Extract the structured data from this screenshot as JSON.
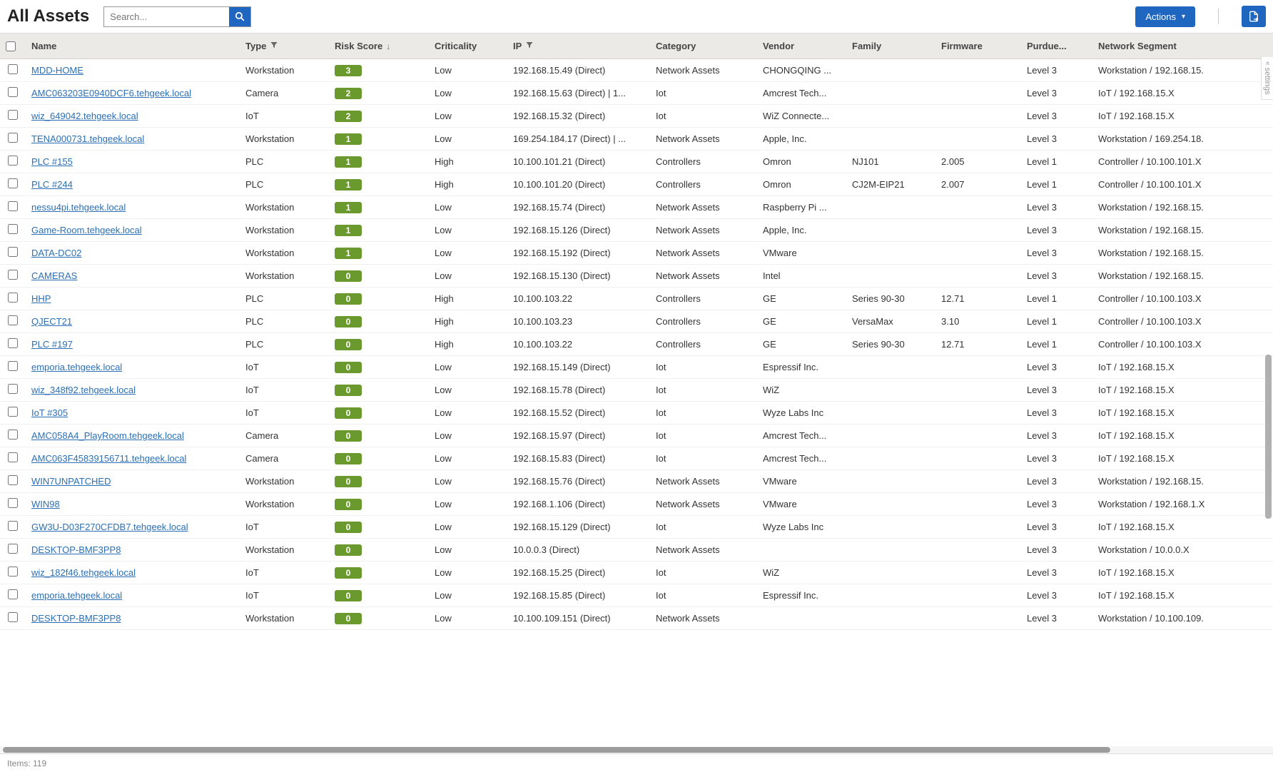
{
  "header": {
    "title": "All Assets",
    "search_placeholder": "Search...",
    "actions_label": "Actions"
  },
  "footer": {
    "items_label": "Items: 119"
  },
  "settings_tab": "settings",
  "columns": [
    {
      "key": "checkbox",
      "label": ""
    },
    {
      "key": "name",
      "label": "Name"
    },
    {
      "key": "type",
      "label": "Type",
      "filter": true
    },
    {
      "key": "risk",
      "label": "Risk Score",
      "sort": "down"
    },
    {
      "key": "crit",
      "label": "Criticality"
    },
    {
      "key": "ip",
      "label": "IP",
      "filter": true
    },
    {
      "key": "cat",
      "label": "Category"
    },
    {
      "key": "vendor",
      "label": "Vendor"
    },
    {
      "key": "family",
      "label": "Family"
    },
    {
      "key": "firmware",
      "label": "Firmware"
    },
    {
      "key": "purdue",
      "label": "Purdue..."
    },
    {
      "key": "seg",
      "label": "Network Segment"
    }
  ],
  "rows": [
    {
      "name": "MDD-HOME",
      "type": "Workstation",
      "risk": "3",
      "crit": "Low",
      "ip": "192.168.15.49 (Direct)",
      "cat": "Network Assets",
      "vendor": "CHONGQING ...",
      "family": "",
      "firmware": "",
      "purdue": "Level 3",
      "seg": "Workstation / 192.168.15."
    },
    {
      "name": "AMC063203E0940DCF6.tehgeek.local",
      "type": "Camera",
      "risk": "2",
      "crit": "Low",
      "ip": "192.168.15.63 (Direct) | 1...",
      "cat": "Iot",
      "vendor": "Amcrest Tech...",
      "family": "",
      "firmware": "",
      "purdue": "Level 3",
      "seg": "IoT / 192.168.15.X"
    },
    {
      "name": "wiz_649042.tehgeek.local",
      "type": "IoT",
      "risk": "2",
      "crit": "Low",
      "ip": "192.168.15.32 (Direct)",
      "cat": "Iot",
      "vendor": "WiZ Connecte...",
      "family": "",
      "firmware": "",
      "purdue": "Level 3",
      "seg": "IoT / 192.168.15.X"
    },
    {
      "name": "TENA000731.tehgeek.local",
      "type": "Workstation",
      "risk": "1",
      "crit": "Low",
      "ip": "169.254.184.17 (Direct) | ...",
      "cat": "Network Assets",
      "vendor": "Apple, Inc.",
      "family": "",
      "firmware": "",
      "purdue": "Level 3",
      "seg": "Workstation / 169.254.18."
    },
    {
      "name": "PLC #155",
      "type": "PLC",
      "risk": "1",
      "crit": "High",
      "ip": "10.100.101.21 (Direct)",
      "cat": "Controllers",
      "vendor": "Omron",
      "family": "NJ101",
      "firmware": "2.005",
      "purdue": "Level 1",
      "seg": "Controller / 10.100.101.X"
    },
    {
      "name": "PLC #244",
      "type": "PLC",
      "risk": "1",
      "crit": "High",
      "ip": "10.100.101.20 (Direct)",
      "cat": "Controllers",
      "vendor": "Omron",
      "family": "CJ2M-EIP21",
      "firmware": "2.007",
      "purdue": "Level 1",
      "seg": "Controller / 10.100.101.X"
    },
    {
      "name": "nessu4pi.tehgeek.local",
      "type": "Workstation",
      "risk": "1",
      "crit": "Low",
      "ip": "192.168.15.74 (Direct)",
      "cat": "Network Assets",
      "vendor": "Raspberry Pi ...",
      "family": "",
      "firmware": "",
      "purdue": "Level 3",
      "seg": "Workstation / 192.168.15."
    },
    {
      "name": "Game-Room.tehgeek.local",
      "type": "Workstation",
      "risk": "1",
      "crit": "Low",
      "ip": "192.168.15.126 (Direct)",
      "cat": "Network Assets",
      "vendor": "Apple, Inc.",
      "family": "",
      "firmware": "",
      "purdue": "Level 3",
      "seg": "Workstation / 192.168.15."
    },
    {
      "name": "DATA-DC02",
      "type": "Workstation",
      "risk": "1",
      "crit": "Low",
      "ip": "192.168.15.192 (Direct)",
      "cat": "Network Assets",
      "vendor": "VMware",
      "family": "",
      "firmware": "",
      "purdue": "Level 3",
      "seg": "Workstation / 192.168.15."
    },
    {
      "name": "CAMERAS",
      "type": "Workstation",
      "risk": "0",
      "crit": "Low",
      "ip": "192.168.15.130 (Direct)",
      "cat": "Network Assets",
      "vendor": "Intel",
      "family": "",
      "firmware": "",
      "purdue": "Level 3",
      "seg": "Workstation / 192.168.15."
    },
    {
      "name": "HHP",
      "type": "PLC",
      "risk": "0",
      "crit": "High",
      "ip": "10.100.103.22",
      "cat": "Controllers",
      "vendor": "GE",
      "family": "Series 90-30",
      "firmware": "12.71",
      "purdue": "Level 1",
      "seg": "Controller / 10.100.103.X"
    },
    {
      "name": "QJECT21",
      "type": "PLC",
      "risk": "0",
      "crit": "High",
      "ip": "10.100.103.23",
      "cat": "Controllers",
      "vendor": "GE",
      "family": "VersaMax",
      "firmware": "3.10",
      "purdue": "Level 1",
      "seg": "Controller / 10.100.103.X"
    },
    {
      "name": "PLC #197",
      "type": "PLC",
      "risk": "0",
      "crit": "High",
      "ip": "10.100.103.22",
      "cat": "Controllers",
      "vendor": "GE",
      "family": "Series 90-30",
      "firmware": "12.71",
      "purdue": "Level 1",
      "seg": "Controller / 10.100.103.X"
    },
    {
      "name": "emporia.tehgeek.local",
      "type": "IoT",
      "risk": "0",
      "crit": "Low",
      "ip": "192.168.15.149 (Direct)",
      "cat": "Iot",
      "vendor": "Espressif Inc.",
      "family": "",
      "firmware": "",
      "purdue": "Level 3",
      "seg": "IoT / 192.168.15.X"
    },
    {
      "name": "wiz_348f92.tehgeek.local",
      "type": "IoT",
      "risk": "0",
      "crit": "Low",
      "ip": "192.168.15.78 (Direct)",
      "cat": "Iot",
      "vendor": "WiZ",
      "family": "",
      "firmware": "",
      "purdue": "Level 3",
      "seg": "IoT / 192.168.15.X"
    },
    {
      "name": "IoT #305",
      "type": "IoT",
      "risk": "0",
      "crit": "Low",
      "ip": "192.168.15.52 (Direct)",
      "cat": "Iot",
      "vendor": "Wyze Labs Inc",
      "family": "",
      "firmware": "",
      "purdue": "Level 3",
      "seg": "IoT / 192.168.15.X"
    },
    {
      "name": "AMC058A4_PlayRoom.tehgeek.local",
      "type": "Camera",
      "risk": "0",
      "crit": "Low",
      "ip": "192.168.15.97 (Direct)",
      "cat": "Iot",
      "vendor": "Amcrest Tech...",
      "family": "",
      "firmware": "",
      "purdue": "Level 3",
      "seg": "IoT / 192.168.15.X"
    },
    {
      "name": "AMC063F45839156711.tehgeek.local",
      "type": "Camera",
      "risk": "0",
      "crit": "Low",
      "ip": "192.168.15.83 (Direct)",
      "cat": "Iot",
      "vendor": "Amcrest Tech...",
      "family": "",
      "firmware": "",
      "purdue": "Level 3",
      "seg": "IoT / 192.168.15.X"
    },
    {
      "name": "WIN7UNPATCHED",
      "type": "Workstation",
      "risk": "0",
      "crit": "Low",
      "ip": "192.168.15.76 (Direct)",
      "cat": "Network Assets",
      "vendor": "VMware",
      "family": "",
      "firmware": "",
      "purdue": "Level 3",
      "seg": "Workstation / 192.168.15."
    },
    {
      "name": "WIN98",
      "type": "Workstation",
      "risk": "0",
      "crit": "Low",
      "ip": "192.168.1.106 (Direct)",
      "cat": "Network Assets",
      "vendor": "VMware",
      "family": "",
      "firmware": "",
      "purdue": "Level 3",
      "seg": "Workstation / 192.168.1.X"
    },
    {
      "name": "GW3U-D03F270CFDB7.tehgeek.local",
      "type": "IoT",
      "risk": "0",
      "crit": "Low",
      "ip": "192.168.15.129 (Direct)",
      "cat": "Iot",
      "vendor": "Wyze Labs Inc",
      "family": "",
      "firmware": "",
      "purdue": "Level 3",
      "seg": "IoT / 192.168.15.X"
    },
    {
      "name": "DESKTOP-BMF3PP8",
      "type": "Workstation",
      "risk": "0",
      "crit": "Low",
      "ip": "10.0.0.3 (Direct)",
      "cat": "Network Assets",
      "vendor": "",
      "family": "",
      "firmware": "",
      "purdue": "Level 3",
      "seg": "Workstation / 10.0.0.X"
    },
    {
      "name": "wiz_182f46.tehgeek.local",
      "type": "IoT",
      "risk": "0",
      "crit": "Low",
      "ip": "192.168.15.25 (Direct)",
      "cat": "Iot",
      "vendor": "WiZ",
      "family": "",
      "firmware": "",
      "purdue": "Level 3",
      "seg": "IoT / 192.168.15.X"
    },
    {
      "name": "emporia.tehgeek.local",
      "type": "IoT",
      "risk": "0",
      "crit": "Low",
      "ip": "192.168.15.85 (Direct)",
      "cat": "Iot",
      "vendor": "Espressif Inc.",
      "family": "",
      "firmware": "",
      "purdue": "Level 3",
      "seg": "IoT / 192.168.15.X"
    },
    {
      "name": "DESKTOP-BMF3PP8",
      "type": "Workstation",
      "risk": "0",
      "crit": "Low",
      "ip": "10.100.109.151 (Direct)",
      "cat": "Network Assets",
      "vendor": "",
      "family": "",
      "firmware": "",
      "purdue": "Level 3",
      "seg": "Workstation / 10.100.109."
    }
  ]
}
